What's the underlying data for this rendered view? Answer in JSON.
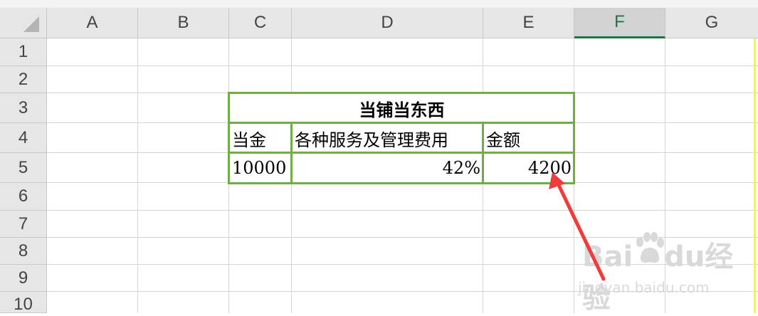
{
  "columns": [
    "A",
    "B",
    "C",
    "D",
    "E",
    "F",
    "G"
  ],
  "rows": [
    "1",
    "2",
    "3",
    "4",
    "5",
    "6",
    "7",
    "8",
    "9",
    "10"
  ],
  "selected_column": "F",
  "table": {
    "title": "当铺当东西",
    "headers": [
      "当金",
      "各种服务及管理费用",
      "金额"
    ],
    "values": [
      "10000",
      "42%",
      "4200"
    ]
  },
  "colors": {
    "table_border": "#70ad47",
    "selected_header_text": "#217346",
    "annotation_arrow": "#f03c3c",
    "edge_highlight": "#ffff00"
  },
  "watermark": {
    "brand": "Bai",
    "brand_suffix": "du",
    "product": "经验",
    "url": "jingyan.baidu.com"
  }
}
